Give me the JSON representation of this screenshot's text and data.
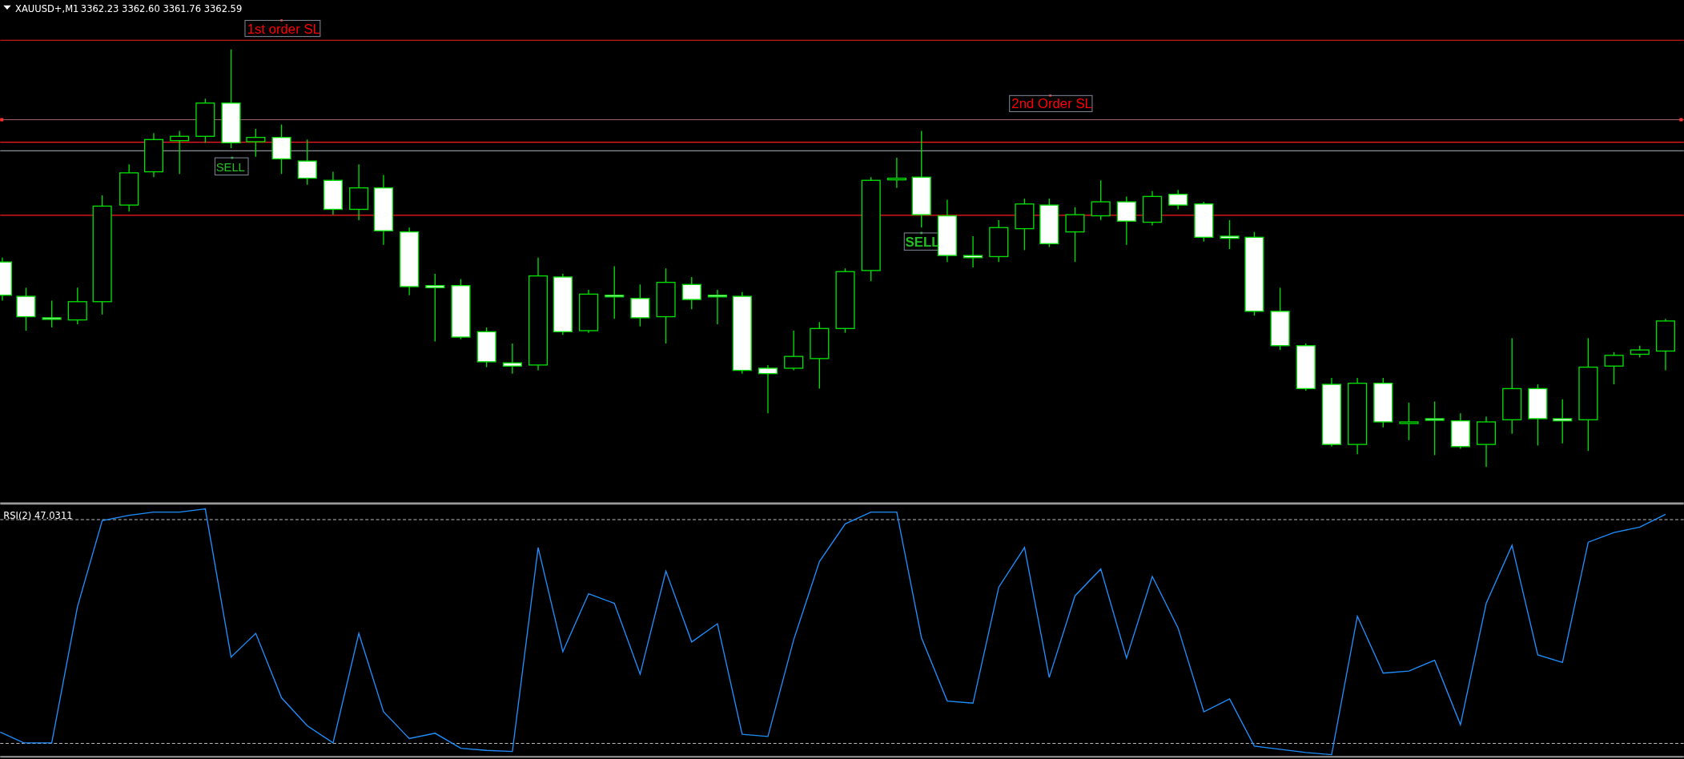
{
  "header": {
    "symbol": "XAUUSD+,M1",
    "quotes": "3362.23 3362.60 3361.76 3362.59"
  },
  "line_labels": [
    {
      "text": "1st order SL",
      "kind": "stop-loss"
    },
    {
      "text": "2nd Order SL",
      "kind": "stop-loss"
    }
  ],
  "signals": [
    {
      "text": "SELL",
      "kind": "outline"
    },
    {
      "text": "SELL",
      "kind": "bold"
    }
  ],
  "indicator": {
    "label": "RSI(2) 47.0311"
  }
}
